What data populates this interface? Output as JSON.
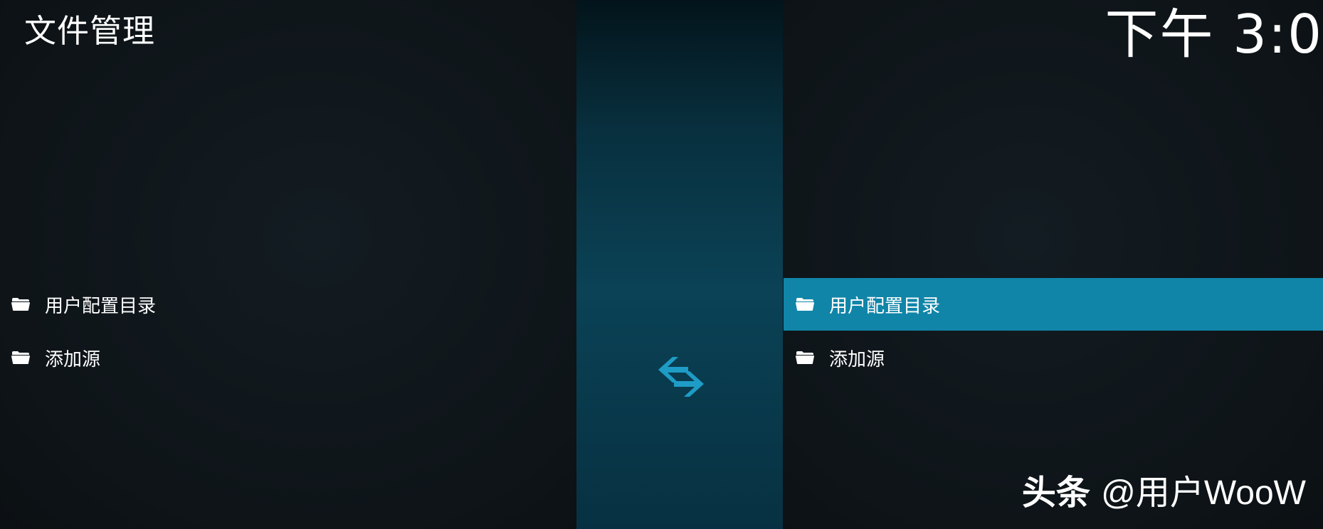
{
  "header": {
    "title": "文件管理",
    "clock": "下午 3:0"
  },
  "left_pane": {
    "items": [
      {
        "label": "用户配置目录",
        "icon": "folder-icon"
      },
      {
        "label": "添加源",
        "icon": "folder-icon"
      }
    ]
  },
  "right_pane": {
    "items": [
      {
        "label": "用户配置目录",
        "icon": "folder-icon",
        "selected": true
      },
      {
        "label": "添加源",
        "icon": "folder-icon"
      }
    ]
  },
  "divider": {
    "icon": "swap-arrows-icon"
  },
  "watermark": {
    "brand": "头条",
    "handle": "@用户WooW"
  },
  "colors": {
    "accent": "#1085a8",
    "icon_accent": "#1e9cc6",
    "background": "#0d1216",
    "text": "#ffffff"
  }
}
